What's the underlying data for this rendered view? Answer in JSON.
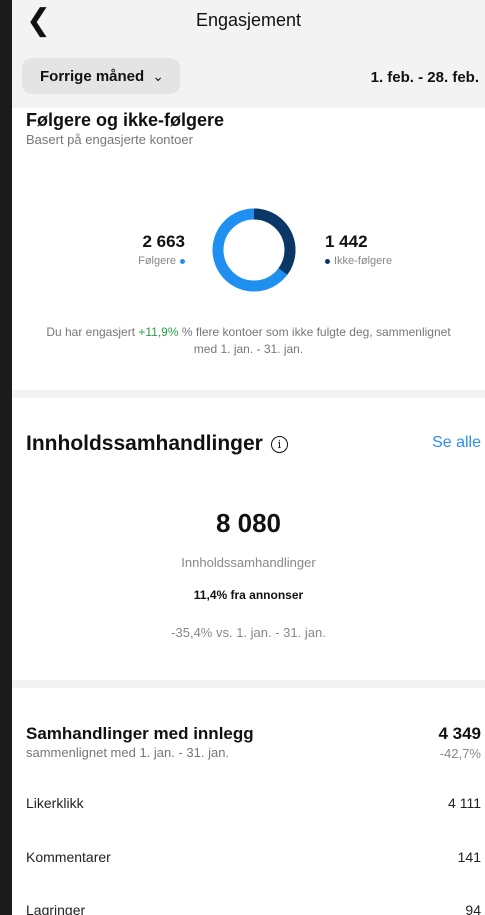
{
  "header": {
    "back_glyph": "❮",
    "title": "Engasjement"
  },
  "filter": {
    "period_label": "Forrige måned",
    "date_range": "1. feb. - 28. feb."
  },
  "audience": {
    "title": "Følgere og ikke-følgere",
    "subtitle": "Basert på engasjerte kontoer",
    "followers": {
      "value": "2 663",
      "label": "Følgere",
      "color": "#1f8ff0",
      "fraction": 0.649
    },
    "non_followers": {
      "value": "1 442",
      "label": "Ikke-følgere",
      "color": "#0a3766",
      "fraction": 0.351
    },
    "note_prefix": "Du har engasjert ",
    "note_highlight": "+11,9%",
    "note_suffix": " % flere kontoer som ikke fulgte deg, sammenlignet med 1. jan. - 31. jan.",
    "highlight_color": "#25a244"
  },
  "content": {
    "title": "Innholdssamhandlinger",
    "info_icon": "info-icon",
    "see_all": "Se alle",
    "total": "8 080",
    "total_label": "Innholdssamhandlinger",
    "ads_share": "11,4% fra annonser",
    "comparison": "-35,4% vs. 1. jan. - 31. jan."
  },
  "posts": {
    "title": "Samhandlinger med innlegg",
    "subtitle": "sammenlignet med 1. jan. - 31. jan.",
    "total": "4 349",
    "change": "-42,7%",
    "rows": [
      {
        "label": "Likerklikk",
        "value": "4 111"
      },
      {
        "label": "Kommentarer",
        "value": "141"
      },
      {
        "label": "Lagringer",
        "value": "94"
      }
    ]
  },
  "colors": {
    "accent": "#2a8ff0"
  }
}
